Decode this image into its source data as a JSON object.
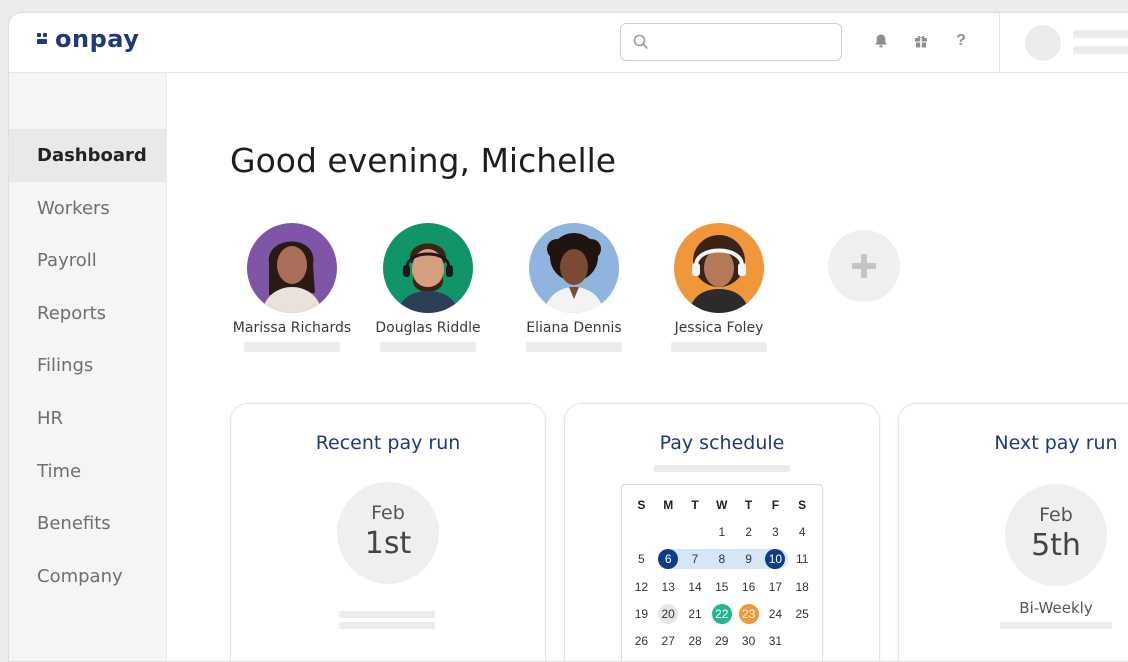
{
  "brand": {
    "logo_text": "onpay",
    "color": "#1d3a7a"
  },
  "search": {
    "placeholder": "",
    "icon": "search-icon"
  },
  "header_icons": [
    "bell-icon",
    "gift-icon",
    "help-icon"
  ],
  "header_help_glyph": "?",
  "sidebar": {
    "items": [
      {
        "label": "Dashboard",
        "active": true
      },
      {
        "label": "Workers"
      },
      {
        "label": "Payroll"
      },
      {
        "label": "Reports"
      },
      {
        "label": "Filings"
      },
      {
        "label": "HR"
      },
      {
        "label": "Time"
      },
      {
        "label": "Benefits"
      },
      {
        "label": "Company"
      }
    ]
  },
  "greeting": "Good evening, Michelle",
  "people": [
    {
      "name": "Marissa Richards",
      "bg": "#7f55a8"
    },
    {
      "name": "Douglas Riddle",
      "bg": "#119467"
    },
    {
      "name": "Eliana Dennis",
      "bg": "#8fb4de"
    },
    {
      "name": "Jessica Foley",
      "bg": "#f0973c"
    }
  ],
  "add_person_icon": "plus-icon",
  "cards": {
    "recent": {
      "title": "Recent pay run",
      "month": "Feb",
      "day": "1st"
    },
    "schedule": {
      "title": "Pay schedule",
      "weekdays": [
        "S",
        "M",
        "T",
        "W",
        "T",
        "F",
        "S"
      ],
      "weeks": [
        [
          "",
          "",
          "",
          "1",
          "2",
          "3",
          "4"
        ],
        [
          "5",
          "6",
          "7",
          "8",
          "9",
          "10",
          "11"
        ],
        [
          "12",
          "13",
          "14",
          "15",
          "16",
          "17",
          "18"
        ],
        [
          "19",
          "20",
          "21",
          "22",
          "23",
          "24",
          "25"
        ],
        [
          "26",
          "27",
          "28",
          "29",
          "30",
          "31",
          ""
        ]
      ],
      "highlight_colors": {
        "range_end": "#0d3b86",
        "today": "#e6e6e6",
        "green": "#21b68c",
        "orange": "#f0973c",
        "range_band": "#d6e6f7"
      }
    },
    "next": {
      "title": "Next pay run",
      "month": "Feb",
      "day": "5th",
      "frequency": "Bi-Weekly"
    }
  }
}
